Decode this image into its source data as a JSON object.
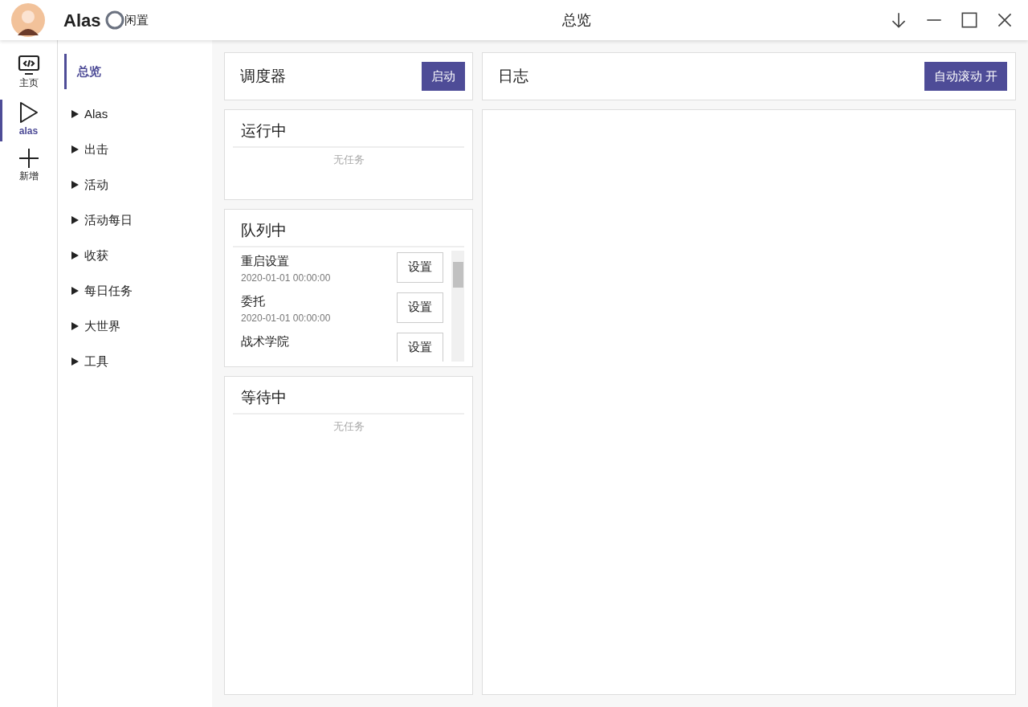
{
  "header": {
    "app_name": "Alas",
    "status": "闲置",
    "title": "总览"
  },
  "rail": [
    {
      "label": "主页",
      "selected": false
    },
    {
      "label": "alas",
      "selected": true
    },
    {
      "label": "新增",
      "selected": false
    }
  ],
  "nav": [
    {
      "label": "总览",
      "kind": "link",
      "selected": true
    },
    {
      "label": "Alas",
      "kind": "group",
      "selected": false
    },
    {
      "label": "出击",
      "kind": "group",
      "selected": false
    },
    {
      "label": "活动",
      "kind": "group",
      "selected": false
    },
    {
      "label": "活动每日",
      "kind": "group",
      "selected": false
    },
    {
      "label": "收获",
      "kind": "group",
      "selected": false
    },
    {
      "label": "每日任务",
      "kind": "group",
      "selected": false
    },
    {
      "label": "大世界",
      "kind": "group",
      "selected": false
    },
    {
      "label": "工具",
      "kind": "group",
      "selected": false
    }
  ],
  "scheduler": {
    "title": "调度器",
    "button": "启动"
  },
  "running": {
    "title": "运行中",
    "empty": "无任务"
  },
  "pending": {
    "title": "队列中",
    "tasks": [
      {
        "name": "重启设置",
        "time": "2020-01-01 00:00:00",
        "button": "设置"
      },
      {
        "name": "委托",
        "time": "2020-01-01 00:00:00",
        "button": "设置"
      },
      {
        "name": "战术学院",
        "button": "设置"
      }
    ]
  },
  "waiting": {
    "title": "等待中",
    "empty": "无任务"
  },
  "log": {
    "title": "日志",
    "button": "自动滚动 开"
  }
}
